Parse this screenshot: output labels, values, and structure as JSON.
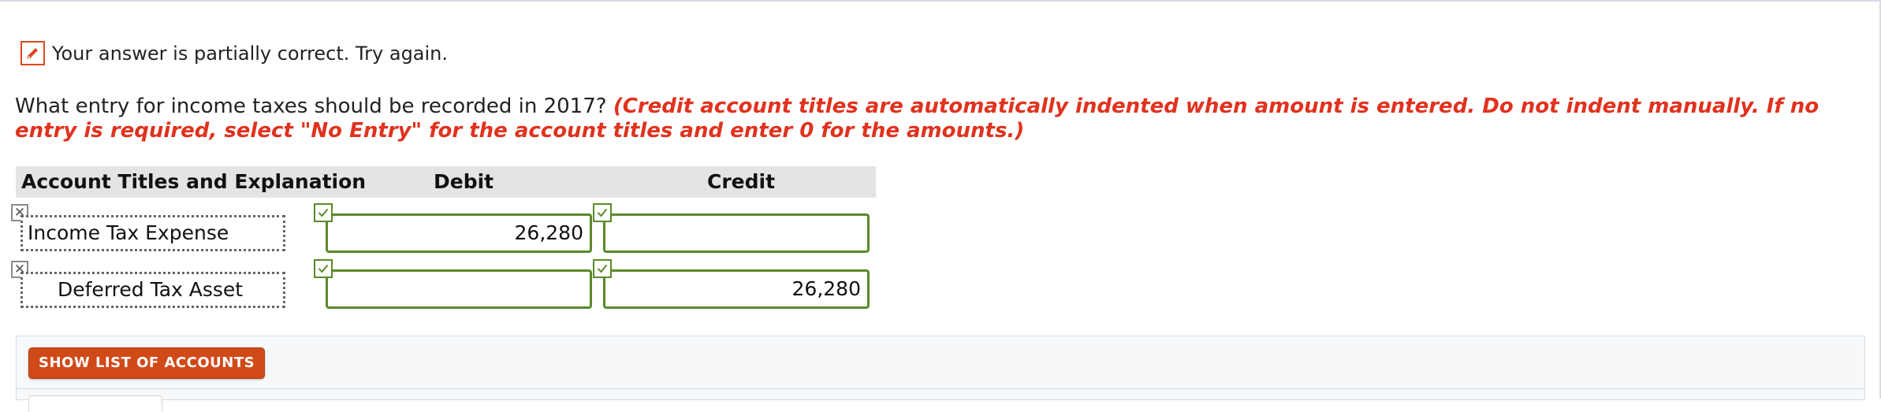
{
  "status": {
    "message": "Your answer is partially correct.  Try again.",
    "icon": "pencil-icon",
    "accent": "#d94a1e"
  },
  "question": {
    "text": "What entry for income taxes should be recorded in 2017?",
    "instructions": "(Credit account titles are automatically indented when amount is entered. Do not indent manually. If no entry is required, select \"No Entry\" for the account titles and enter 0 for the amounts.)",
    "instructions_color": "#e0321e"
  },
  "table": {
    "headers": {
      "account": "Account Titles and Explanation",
      "debit": "Debit",
      "credit": "Credit"
    },
    "rows": [
      {
        "account": "Income Tax Expense",
        "debit": "26,280",
        "credit": ""
      },
      {
        "account": "Deferred Tax Asset",
        "debit": "",
        "credit": "26,280"
      }
    ],
    "correct_color": "#5a8a2a"
  },
  "actions": {
    "show_list_label": "SHOW LIST OF ACCOUNTS",
    "button_color": "#d04a18"
  }
}
